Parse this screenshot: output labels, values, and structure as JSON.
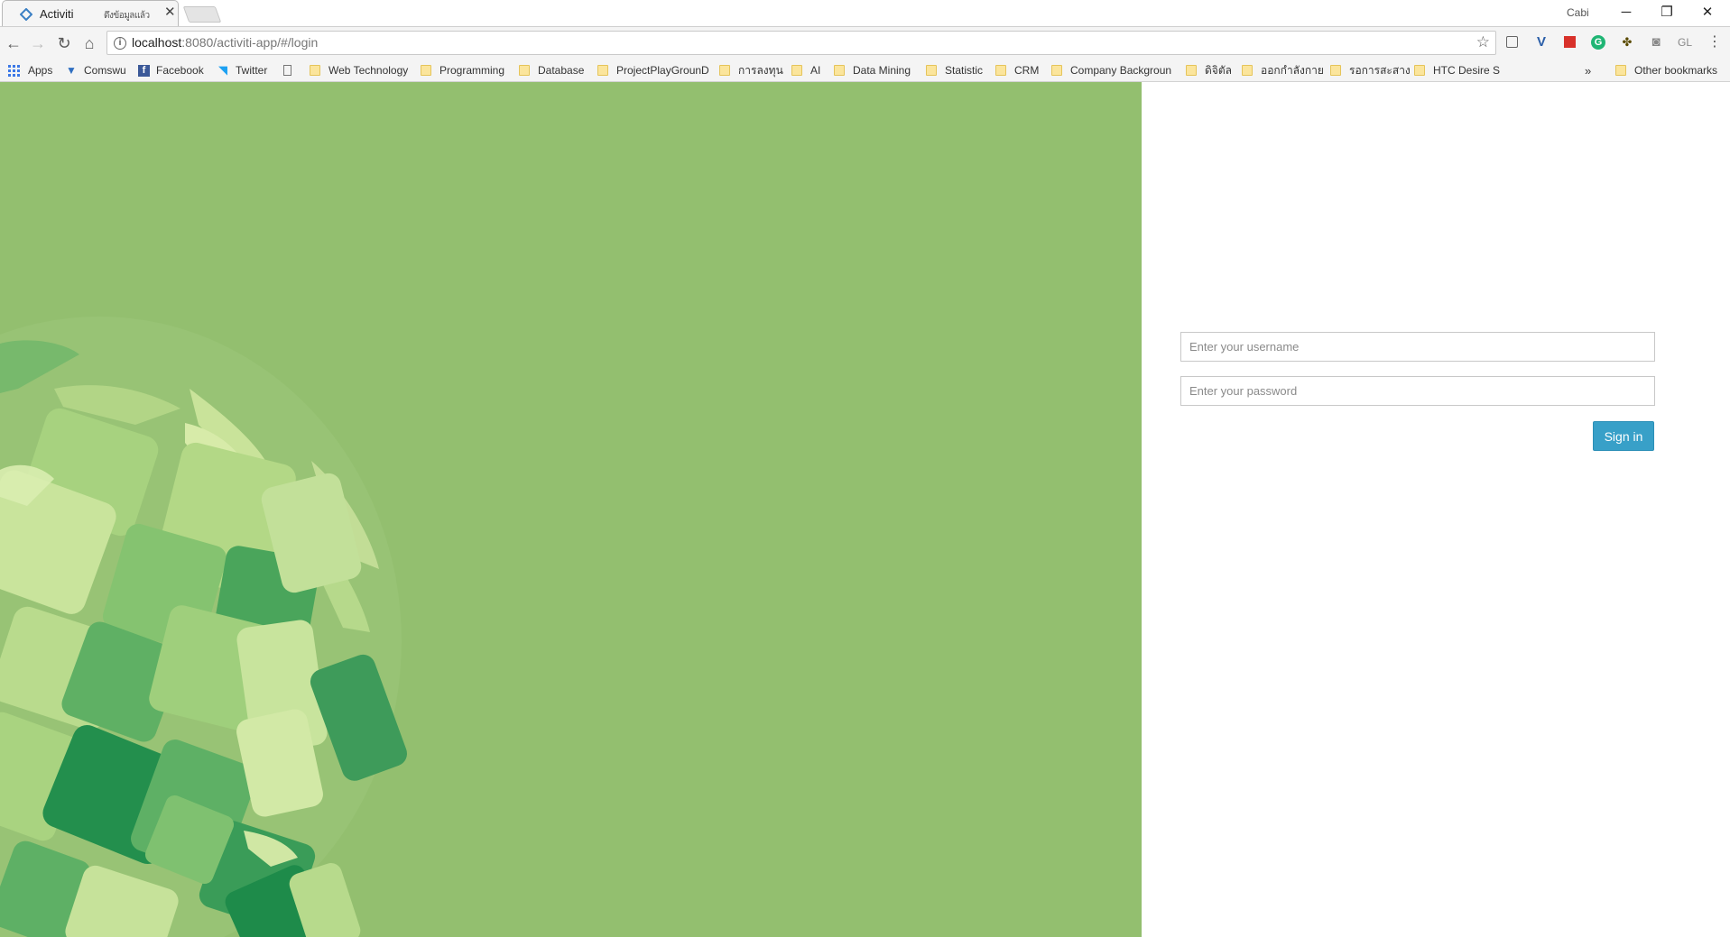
{
  "browser": {
    "tab": {
      "title": "Activiti",
      "extra": "ดึงข้อมูลแล้ว",
      "close_glyph": "✕"
    },
    "profile_name": "Cabi",
    "window": {
      "minimize": "─",
      "restore": "❐",
      "close": "✕"
    },
    "url": {
      "host": "localhost",
      "rest": ":8080/activiti-app/#/login"
    },
    "extensions": [
      "document-icon",
      "vivaldi-v-icon",
      "red-square-icon",
      "grammarly-g-icon",
      "bee-icon",
      "camera-icon",
      "gl-icon",
      "menu-dots-icon"
    ],
    "extension_labels": {
      "gl": "GL"
    },
    "bookmarks": [
      {
        "label": "Apps",
        "icon": "apps-grid-icon"
      },
      {
        "label": "Comswu",
        "icon": "comswu-icon"
      },
      {
        "label": "Facebook",
        "icon": "facebook-icon"
      },
      {
        "label": "Twitter",
        "icon": "twitter-icon"
      },
      {
        "label": "",
        "icon": "page-icon"
      },
      {
        "label": "Web Technology",
        "icon": "folder-icon"
      },
      {
        "label": "Programming",
        "icon": "folder-icon"
      },
      {
        "label": "Database",
        "icon": "folder-icon"
      },
      {
        "label": "ProjectPlayGrounD",
        "icon": "folder-icon"
      },
      {
        "label": "การลงทุน",
        "icon": "folder-icon"
      },
      {
        "label": "AI",
        "icon": "folder-icon"
      },
      {
        "label": "Data Mining",
        "icon": "folder-icon"
      },
      {
        "label": "Statistic",
        "icon": "folder-icon"
      },
      {
        "label": "CRM",
        "icon": "folder-icon"
      },
      {
        "label": "Company Backgroun",
        "icon": "folder-icon"
      },
      {
        "label": "ดิจิตัล",
        "icon": "folder-icon"
      },
      {
        "label": "ออกกำลังกาย",
        "icon": "folder-icon"
      },
      {
        "label": "รอการสะสาง",
        "icon": "folder-icon"
      },
      {
        "label": "HTC Desire S",
        "icon": "folder-icon"
      }
    ],
    "overflow": "»",
    "other_bookmarks": "Other bookmarks"
  },
  "login": {
    "username_placeholder": "Enter your username",
    "password_placeholder": "Enter your password",
    "signin_label": "Sign in"
  },
  "colors": {
    "left_background": "#93bf6f",
    "signin_button": "#38a0c8"
  }
}
